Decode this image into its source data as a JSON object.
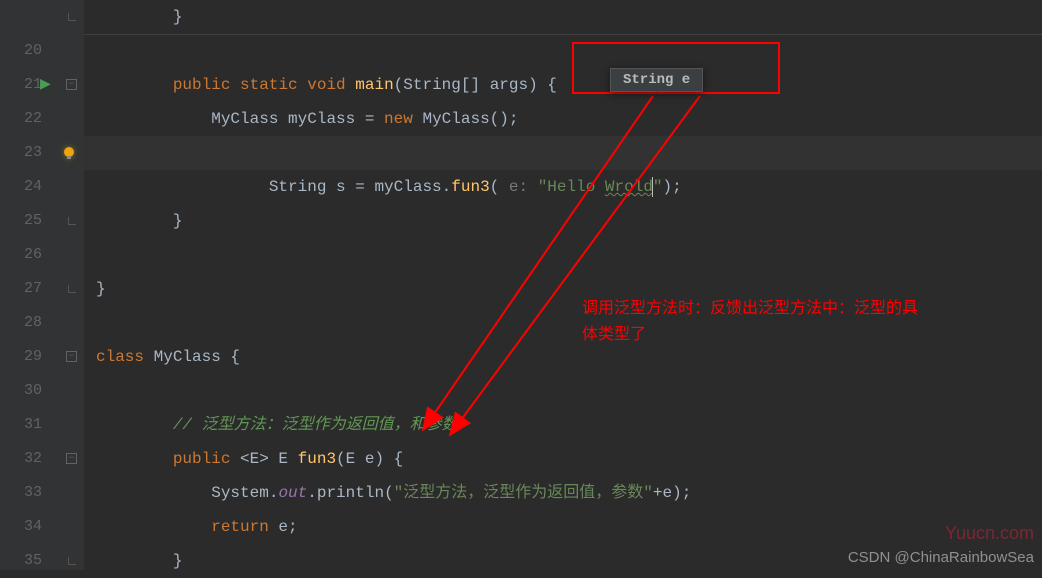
{
  "gutter": {
    "start": 20,
    "end": 35,
    "highlighted": 23,
    "run_line": 21
  },
  "tooltip": "String e",
  "annotation_lines": [
    "调用泛型方法时：反馈出泛型方法中：泛型的具",
    "体类型了"
  ],
  "watermark1": "Yuucn.com",
  "watermark2": "CSDN @ChinaRainbowSea",
  "code": {
    "l20": "",
    "l21_public": "public",
    "l21_static": "static",
    "l21_void": "void",
    "l21_main": "main",
    "l21_args": "(String[] args) {",
    "l22_indent": "            MyClass myClass = ",
    "l22_new": "new",
    "l22_rest": " MyClass();",
    "l23_indent": "            String s = myClass.",
    "l23_fun": "fun3",
    "l23_hint": "e: ",
    "l23_str1": "\"Hello ",
    "l23_str2": "Wrold",
    "l23_str3": "\"",
    "l23_end": ");",
    "l25_brace": "        }",
    "l27_brace": "}",
    "l29_class": "class",
    "l29_rest": " MyClass {",
    "l31_comment": "// 泛型方法：泛型作为返回值，和参数",
    "l32_public": "public",
    "l32_gen": " <E> E ",
    "l32_fun": "fun3",
    "l32_args": "(E e) {",
    "l33_sys": "            System.",
    "l33_out": "out",
    "l33_println": ".println(",
    "l33_str": "\"泛型方法，泛型作为返回值，参数\"",
    "l33_end": "+e);",
    "l34_return": "return",
    "l34_e": " e;",
    "l35_brace": "        }"
  }
}
